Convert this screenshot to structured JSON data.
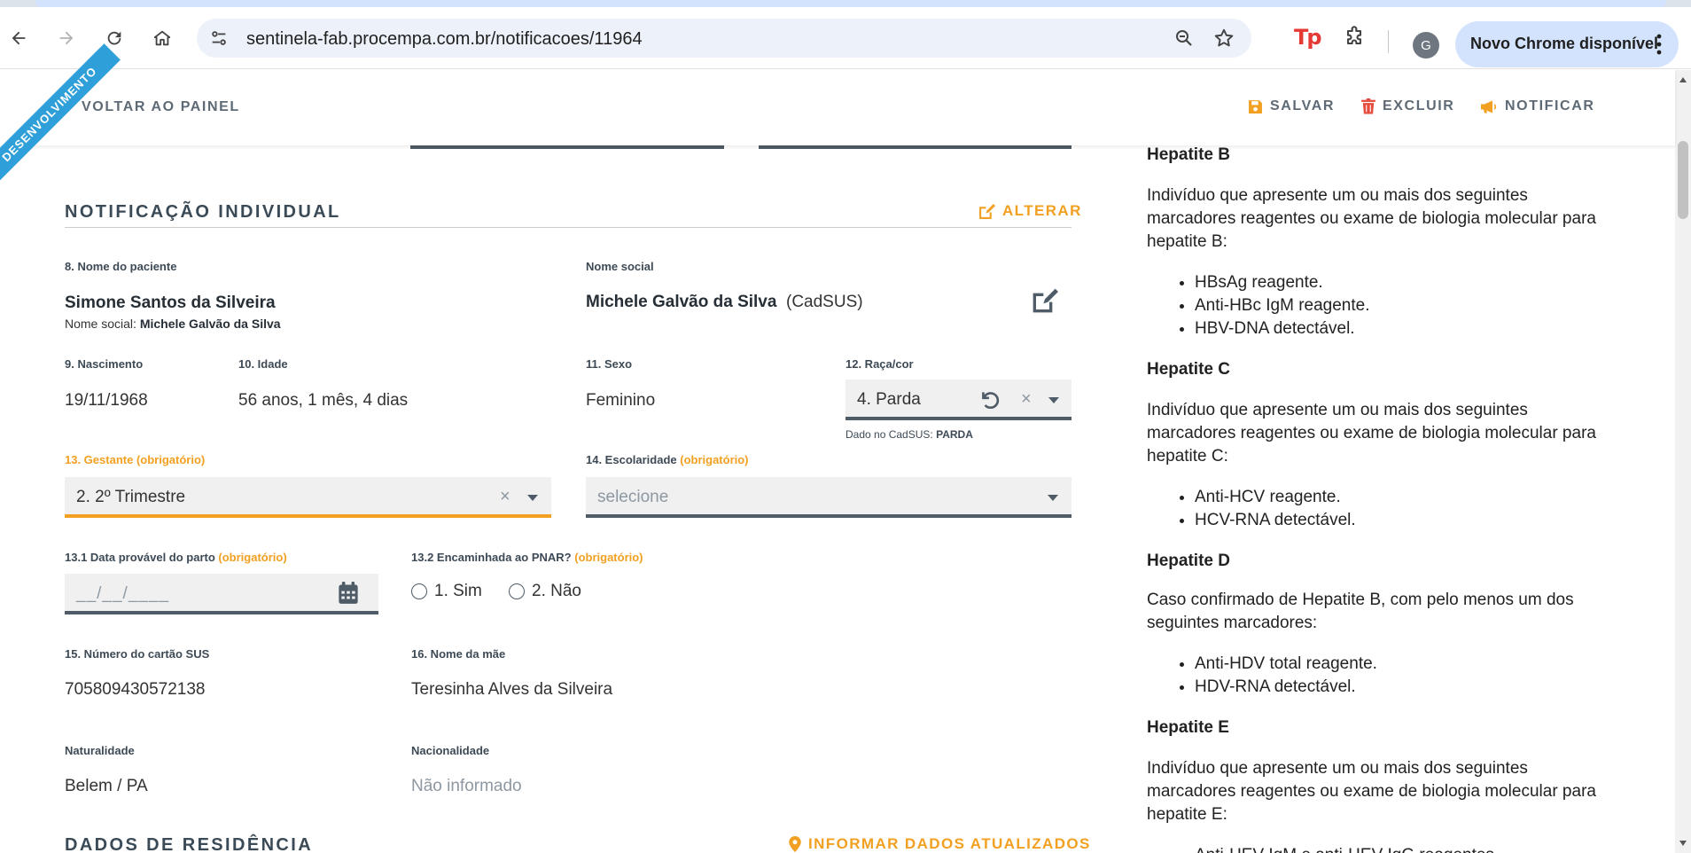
{
  "browser": {
    "url_host": "sentinela-fab.procempa.com.br",
    "url_path": "/notificacoes/11964",
    "avatar_letter": "G",
    "update_label": "Novo Chrome disponível",
    "extension_badge": "Tp"
  },
  "header": {
    "ribbon": "DESENVOLVIMENTO",
    "back_label": "VOLTAR AO PAINEL",
    "save_label": "SALVAR",
    "delete_label": "EXCLUIR",
    "notify_label": "NOTIFICAR"
  },
  "colors": {
    "accent": "#f2a021",
    "danger": "#e74c3c",
    "ribbon": "#2e9fd9",
    "field_border": "#4f5b66"
  },
  "form": {
    "section_title": "NOTIFICAÇÃO INDIVIDUAL",
    "section_action": "ALTERAR",
    "required_tag": "(obrigatório)",
    "patient_name_label": "8. Nome do paciente",
    "patient_name": "Simone Santos da Silveira",
    "patient_social_prefix": "Nome social:",
    "patient_social_value": "Michele Galvão da Silva",
    "social_name_label": "Nome social",
    "social_name": "Michele Galvão da Silva",
    "social_name_source": "(CadSUS)",
    "birth_label": "9. Nascimento",
    "birth": "19/11/1968",
    "age_label": "10. Idade",
    "age": "56 anos, 1 mês, 4 dias",
    "sex_label": "11. Sexo",
    "sex": "Feminino",
    "race_label": "12. Raça/cor",
    "race": "4. Parda",
    "race_cadsus_prefix": "Dado no CadSUS:",
    "race_cadsus_value": "PARDA",
    "pregnant_label": "13. Gestante",
    "pregnant": "2. 2º Trimestre",
    "schooling_label": "14. Escolaridade",
    "schooling_placeholder": "selecione",
    "due_date_label": "13.1 Data provável do parto",
    "due_date_placeholder": "__/__/____",
    "pnar_label": "13.2 Encaminhada ao PNAR?",
    "pnar_option_yes": "1. Sim",
    "pnar_option_no": "2. Não",
    "sus_card_label": "15. Número do cartão SUS",
    "sus_card": "705809430572138",
    "mother_label": "16. Nome da mãe",
    "mother": "Teresinha Alves da Silveira",
    "birthplace_label": "Naturalidade",
    "birthplace": "Belem / PA",
    "nationality_label": "Nacionalidade",
    "nationality": "Não informado",
    "residence_title": "DADOS DE RESIDÊNCIA",
    "residence_action": "INFORMAR DADOS ATUALIZADOS"
  },
  "side_panel": {
    "hep_b": {
      "title": "Hepatite B",
      "text": "Indivíduo que apresente um ou mais dos seguintes marcadores reagentes ou exame de biologia molecular para hepatite B:",
      "items": [
        "HBsAg reagente.",
        "Anti-HBc IgM reagente.",
        "HBV-DNA detectável."
      ]
    },
    "hep_c": {
      "title": "Hepatite C",
      "text": "Indivíduo que apresente um ou mais dos seguintes marcadores reagentes ou exame de biologia molecular para hepatite C:",
      "items": [
        "Anti-HCV reagente.",
        "HCV-RNA detectável."
      ]
    },
    "hep_d": {
      "title": "Hepatite D",
      "text": "Caso confirmado de Hepatite B, com pelo menos um dos seguintes marcadores:",
      "items": [
        "Anti-HDV total reagente.",
        "HDV-RNA detectável."
      ]
    },
    "hep_e": {
      "title": "Hepatite E",
      "text": "Indivíduo que apresente um ou mais dos seguintes marcadores reagentes ou exame de biologia molecular para hepatite E:",
      "items": [
        "Anti-HEV IgM e anti-HEV IgG reagentes."
      ]
    }
  }
}
